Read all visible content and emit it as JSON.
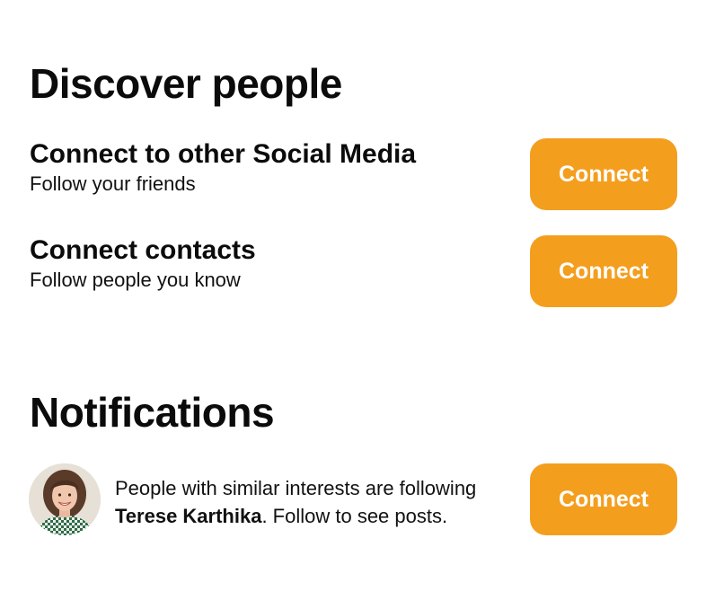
{
  "discover": {
    "title": "Discover people",
    "items": [
      {
        "heading": "Connect to other Social Media",
        "subtitle": "Follow your friends",
        "button_label": "Connect"
      },
      {
        "heading": "Connect contacts",
        "subtitle": "Follow people you know",
        "button_label": "Connect"
      }
    ]
  },
  "notifications": {
    "title": "Notifications",
    "items": [
      {
        "text_before": "People with similar interests are following ",
        "name": "Terese Karthika",
        "text_after": ". Follow to see posts.",
        "button_label": "Connect",
        "avatar_icon": "person-photo-avatar"
      }
    ]
  },
  "colors": {
    "accent": "#f49e1e",
    "text": "#111111",
    "background": "#ffffff"
  }
}
